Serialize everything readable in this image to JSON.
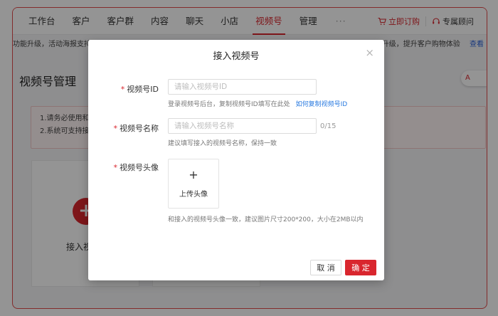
{
  "nav": {
    "items": [
      "工作台",
      "客户",
      "客户群",
      "内容",
      "聊天",
      "小店",
      "视频号",
      "管理"
    ],
    "active_index": 6,
    "more": "···",
    "order_label": "立即订购",
    "advisor_label": "专属顾问"
  },
  "notice": {
    "left_text": "功能升级，活动海报支持",
    "right_text": "升级，提升客户购物体验",
    "right_link": "查看"
  },
  "page": {
    "title": "视频号管理",
    "ai_badge": "A",
    "tips": [
      "1.请务必使用和",
      "2.系统可支持接"
    ],
    "add_card_label": "接入视"
  },
  "modal": {
    "title": "接入视频号",
    "close": "×",
    "fields": {
      "id": {
        "label": "视频号ID",
        "placeholder": "请输入视频号ID",
        "hint": "登录视频号后台，复制视频号ID填写在此处",
        "hint_link": "如何复制视频号ID"
      },
      "name": {
        "label": "视频号名称",
        "placeholder": "请输入视频号名称",
        "counter": "0/15",
        "hint": "建议填写接入的视频号名称，保持一致"
      },
      "avatar": {
        "label": "视频号头像",
        "upload_plus": "+",
        "upload_text": "上传头像",
        "hint": "和接入的视频号头像一致，建议图片尺寸200*200，大小在2MB以内"
      }
    },
    "cancel_label": "取 消",
    "ok_label": "确 定"
  },
  "colors": {
    "accent": "#d9262e",
    "link": "#2b7be0"
  }
}
